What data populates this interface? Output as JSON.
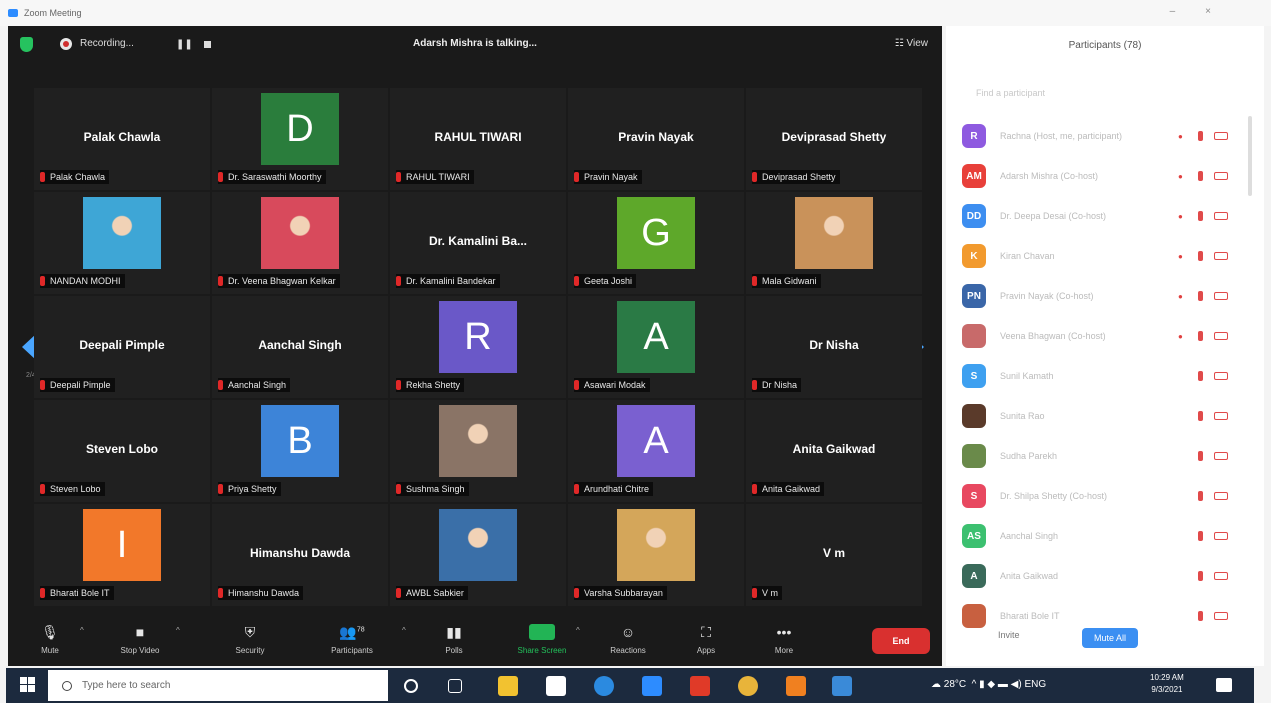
{
  "window": {
    "title": "Zoom Meeting"
  },
  "topbar": {
    "recording_label": "Recording...",
    "pause_glyph": "❚❚",
    "talking_text": "Adarsh Mishra is talking...",
    "view_label": "☷ View"
  },
  "tiles": [
    {
      "big": "Palak Chawla",
      "label": "Palak Chawla"
    },
    {
      "initial": "D",
      "color": "#2a7d3c",
      "label": "Dr. Saraswathi Moorthy"
    },
    {
      "big": "RAHUL TIWARI",
      "label": "RAHUL TIWARI"
    },
    {
      "big": "Pravin Nayak",
      "label": "Pravin Nayak"
    },
    {
      "big": "Deviprasad Shetty",
      "label": "Deviprasad Shetty"
    },
    {
      "photo": "#3ea6d6",
      "label": "NANDAN MODHI"
    },
    {
      "photo": "#d84a5c",
      "label": "Dr. Veena Bhagwan Kelkar"
    },
    {
      "big": "Dr. Kamalini Ba...",
      "label": "Dr. Kamalini Bandekar"
    },
    {
      "initial": "G",
      "color": "#5ea82a",
      "label": "Geeta Joshi"
    },
    {
      "photo": "#c9925a",
      "label": "Mala Gidwani"
    },
    {
      "big": "Deepali Pimple",
      "label": "Deepali Pimple"
    },
    {
      "big": "Aanchal Singh",
      "label": "Aanchal Singh"
    },
    {
      "initial": "R",
      "color": "#6a58c8",
      "label": "Rekha Shetty"
    },
    {
      "initial": "A",
      "color": "#2a7a45",
      "label": "Asawari Modak"
    },
    {
      "big": "Dr Nisha",
      "label": "Dr Nisha"
    },
    {
      "big": "Steven Lobo",
      "label": "Steven Lobo"
    },
    {
      "initial": "B",
      "color": "#3d84d8",
      "label": "Priya Shetty"
    },
    {
      "photo": "#8a7466",
      "label": "Sushma Singh"
    },
    {
      "initial": "A",
      "color": "#7a60d0",
      "label": "Arundhati Chitre"
    },
    {
      "big": "Anita Gaikwad",
      "label": "Anita Gaikwad"
    },
    {
      "initial": "I",
      "color": "#f2782a",
      "label": "Bharati Bole IT"
    },
    {
      "big": "Himanshu Dawda",
      "label": "Himanshu Dawda"
    },
    {
      "photo": "#3a6fa8",
      "label": "AWBL Sabkier"
    },
    {
      "photo": "#d4a65a",
      "label": "Varsha Subbarayan"
    },
    {
      "big": "V m",
      "label": "V m"
    }
  ],
  "toolbar": {
    "mute": "Mute",
    "stop_video": "Stop Video",
    "security": "Security",
    "participants": "Participants",
    "participants_count": "78",
    "polls": "Polls",
    "share_screen": "Share Screen",
    "reactions": "Reactions",
    "apps": "Apps",
    "more": "More",
    "end": "End"
  },
  "panel": {
    "title": "Participants (78)",
    "search_placeholder": "Find a participant",
    "participants": [
      {
        "initials": "R",
        "color": "#8e5ae0",
        "name": "Rachna (Host, me, participant)"
      },
      {
        "initials": "AM",
        "color": "#e8403a",
        "name": "Adarsh Mishra (Co-host)"
      },
      {
        "initials": "DD",
        "color": "#3d8ef0",
        "name": "Dr. Deepa Desai (Co-host)"
      },
      {
        "initials": "K",
        "color": "#f29a2e",
        "name": "Kiran Chavan"
      },
      {
        "initials": "PN",
        "color": "#3a66a8",
        "name": "Pravin Nayak (Co-host)"
      },
      {
        "initials": "",
        "color": "#c86a6a",
        "name": "Veena Bhagwan (Co-host)"
      },
      {
        "initials": "S",
        "color": "#3ea0f0",
        "name": "Sunil Kamath"
      },
      {
        "initials": "",
        "color": "#5a3a2a",
        "name": "Sunita Rao"
      },
      {
        "initials": "",
        "color": "#6a8a4a",
        "name": "Sudha Parekh"
      },
      {
        "initials": "S",
        "color": "#e84860",
        "name": "Dr. Shilpa Shetty (Co-host)"
      },
      {
        "initials": "AS",
        "color": "#3cc070",
        "name": "Aanchal Singh"
      },
      {
        "initials": "A",
        "color": "#3a6a5a",
        "name": "Anita Gaikwad"
      },
      {
        "initials": "",
        "color": "#c86040",
        "name": "Bharati Bole IT"
      }
    ],
    "invite": "Invite",
    "mute_all": "Mute All"
  },
  "taskbar": {
    "search_placeholder": "Type here to search",
    "temperature": "28°C",
    "lang": "ENG",
    "time": "10:29 AM",
    "date": "9/3/2021"
  }
}
